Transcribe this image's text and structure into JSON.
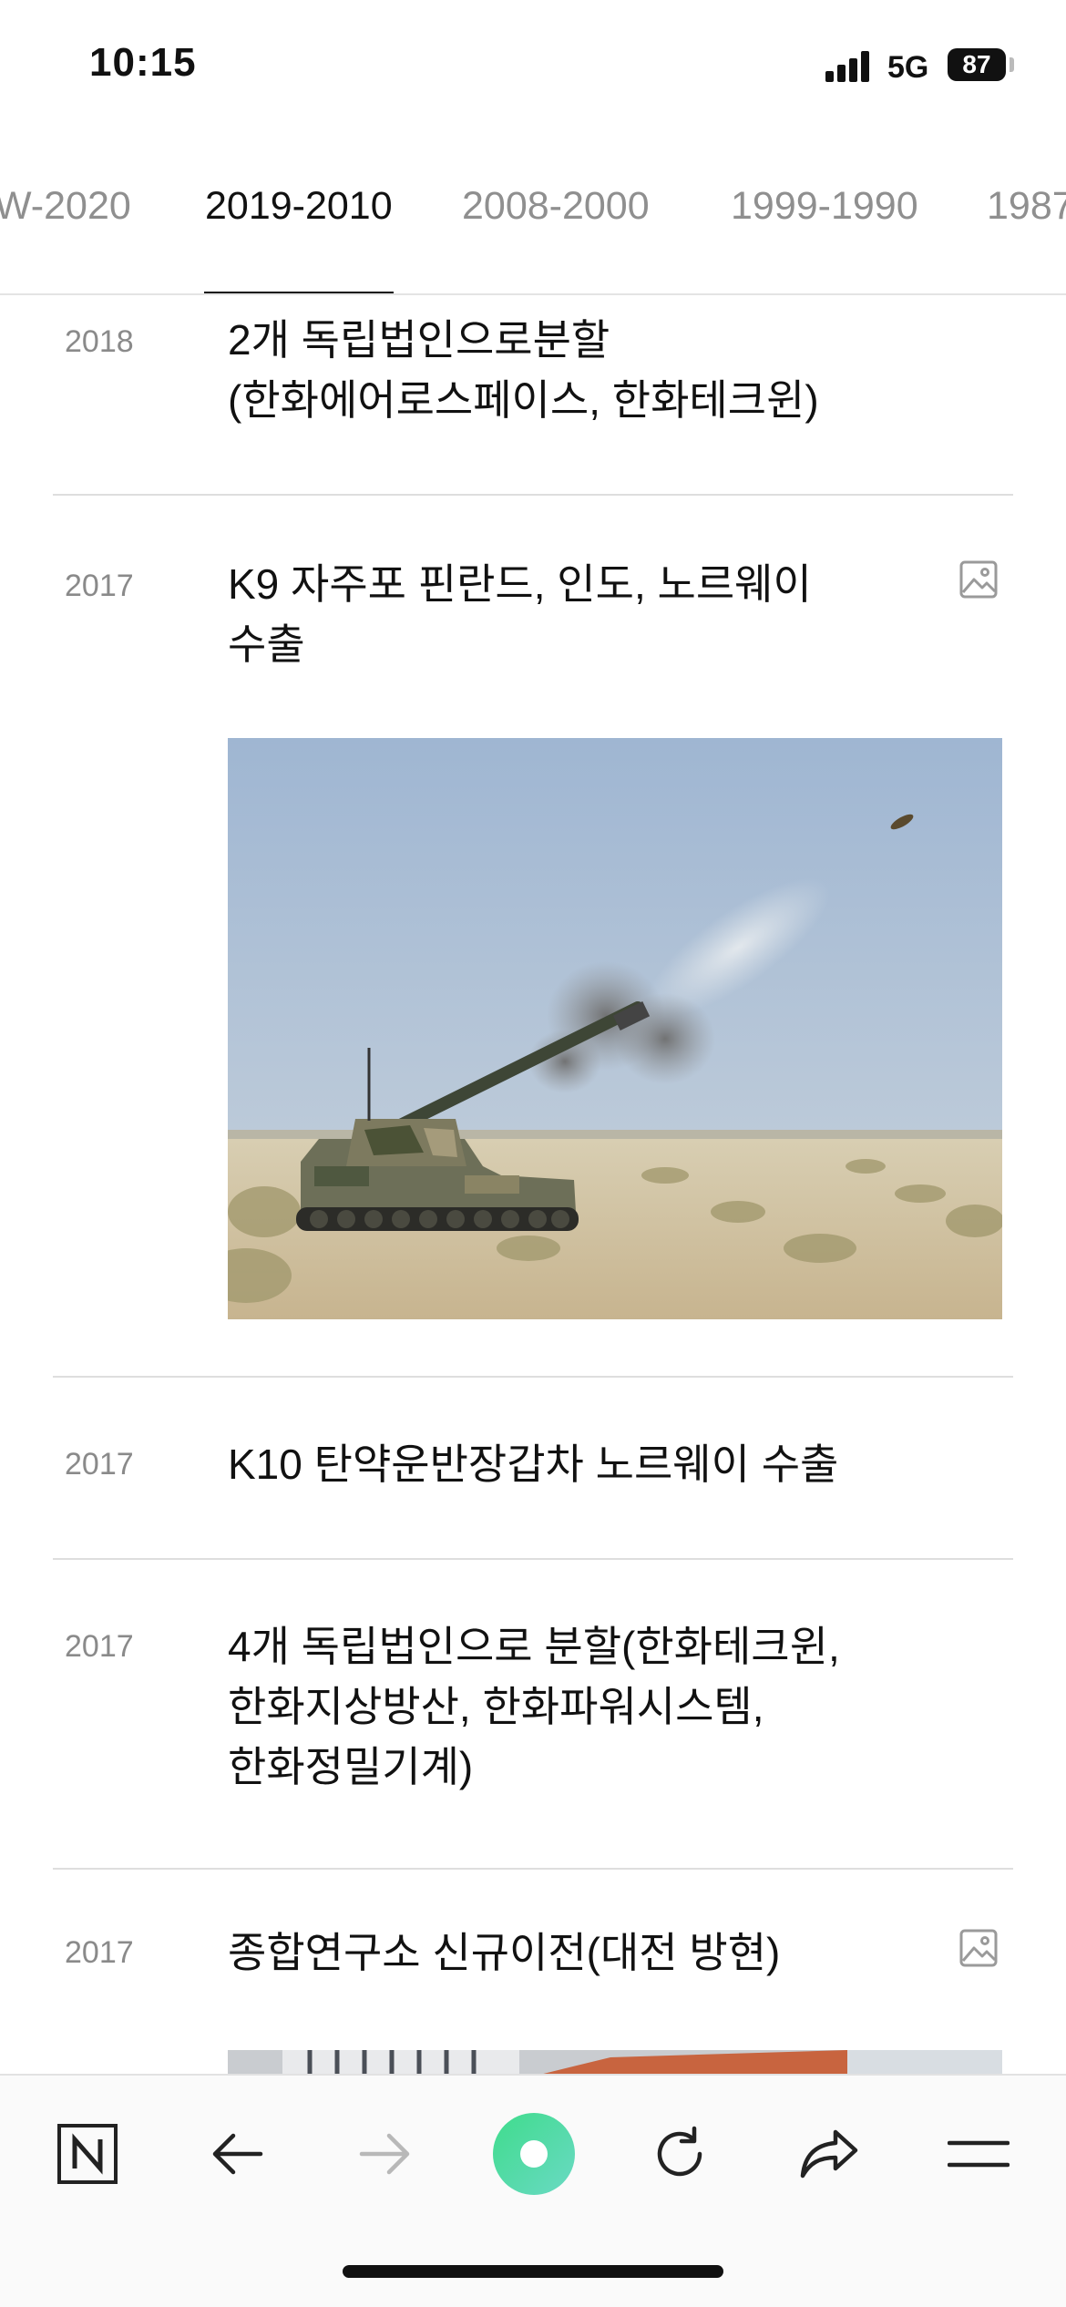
{
  "status_bar": {
    "time": "10:15",
    "network": "5G",
    "battery": "87"
  },
  "tabs": [
    {
      "label": "W-2020",
      "active": false
    },
    {
      "label": "2019-2010",
      "active": true
    },
    {
      "label": "2008-2000",
      "active": false
    },
    {
      "label": "1999-1990",
      "active": false
    },
    {
      "label": "1987",
      "active": false
    }
  ],
  "entries": [
    {
      "year": "2018",
      "text": "2개 독립법인으로분할\n(한화에어로스페이스, 한화테크윈)",
      "has_image_icon": false
    },
    {
      "year": "2017",
      "text": "K9 자주포 핀란드, 인도, 노르웨이\n수출",
      "has_image_icon": true,
      "image_icon": "image-icon"
    },
    {
      "year": "2017",
      "text": "K10 탄약운반장갑차 노르웨이 수출",
      "has_image_icon": false
    },
    {
      "year": "2017",
      "text": "4개 독립법인으로 분할(한화테크윈,\n한화지상방산, 한화파워시스템,\n한화정밀기계)",
      "has_image_icon": false
    },
    {
      "year": "2017",
      "text": "종합연구소 신규이전(대전 방현)",
      "has_image_icon": true,
      "image_icon": "image-icon"
    }
  ],
  "toolbar": {
    "items": [
      {
        "name": "naver-home-button",
        "icon": "n-logo-icon"
      },
      {
        "name": "back-button",
        "icon": "arrow-left-icon"
      },
      {
        "name": "forward-button",
        "icon": "arrow-right-icon"
      },
      {
        "name": "green-dot-button",
        "icon": "green-circle-icon"
      },
      {
        "name": "refresh-button",
        "icon": "refresh-icon"
      },
      {
        "name": "share-button",
        "icon": "share-arrow-icon"
      },
      {
        "name": "menu-button",
        "icon": "hamburger-icon"
      }
    ]
  },
  "colors": {
    "accent_green": "#3fd39a",
    "text_primary": "#111111",
    "text_secondary": "#8a8a8a",
    "divider": "#dedede"
  }
}
